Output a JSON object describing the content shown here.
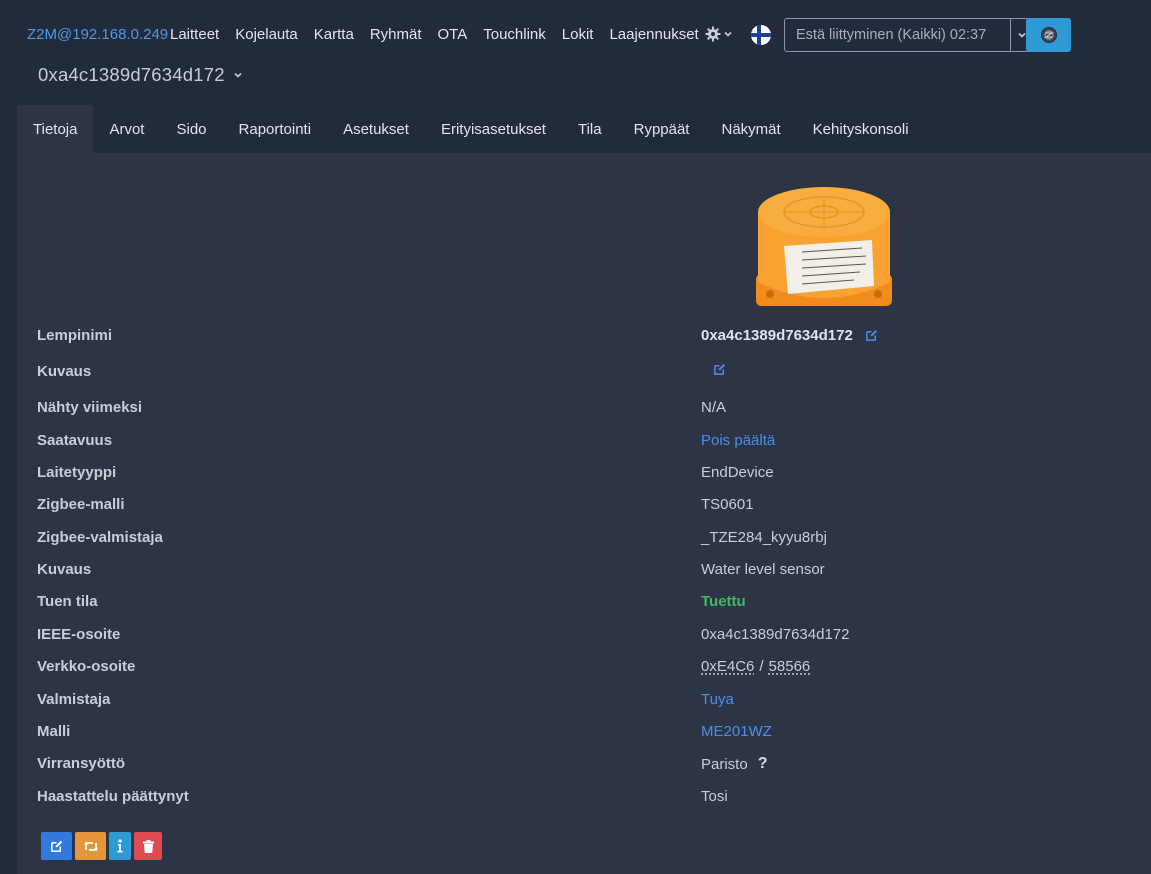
{
  "navbar": {
    "brand": "Z2M@192.168.0.249",
    "links": [
      "Laitteet",
      "Kojelauta",
      "Kartta",
      "Ryhmät",
      "OTA",
      "Touchlink",
      "Lokit",
      "Laajennukset"
    ],
    "settings_icon": "gear-icon",
    "language_icon": "finnish-flag-icon",
    "permit_join_label": "Estä liittyminen (Kaikki) 02:37",
    "permit_dropdown_icon": "chevron-down-icon",
    "zigbee_icon": "zigbee-logo-icon"
  },
  "device": {
    "title": "0xa4c1389d7634d172"
  },
  "tabs": [
    "Tietoja",
    "Arvot",
    "Sido",
    "Raportointi",
    "Asetukset",
    "Erityisasetukset",
    "Tila",
    "Ryppäät",
    "Näkymät",
    "Kehityskonsoli"
  ],
  "active_tab": "Tietoja",
  "info": {
    "friendly_name": {
      "label": "Lempinimi",
      "value": "0xa4c1389d7634d172"
    },
    "description": {
      "label": "Kuvaus",
      "value": ""
    },
    "last_seen": {
      "label": "Nähty viimeksi",
      "value": "N/A"
    },
    "availability": {
      "label": "Saatavuus",
      "value": "Pois päältä"
    },
    "device_type": {
      "label": "Laitetyyppi",
      "value": "EndDevice"
    },
    "zigbee_model": {
      "label": "Zigbee-malli",
      "value": "TS0601"
    },
    "zigbee_manufacturer": {
      "label": "Zigbee-valmistaja",
      "value": "_TZE284_kyyu8rbj"
    },
    "definition_description": {
      "label": "Kuvaus",
      "value": "Water level sensor"
    },
    "support_status": {
      "label": "Tuen tila",
      "value": "Tuettu"
    },
    "ieee_address": {
      "label": "IEEE-osoite",
      "value": "0xa4c1389d7634d172"
    },
    "network_address": {
      "label": "Verkko-osoite",
      "hex": "0xE4C6",
      "separator": "/",
      "dec": "58566"
    },
    "manufacturer": {
      "label": "Valmistaja",
      "value": "Tuya"
    },
    "model": {
      "label": "Malli",
      "value": "ME201WZ"
    },
    "power_source": {
      "label": "Virransyöttö",
      "value": "Paristo",
      "help": "?"
    },
    "interview_completed": {
      "label": "Haastattelu päättynyt",
      "value": "Tosi"
    }
  },
  "actions": {
    "rename_icon": "edit-icon",
    "reconfigure_icon": "retweet-icon",
    "interview_icon": "info-icon",
    "remove_icon": "trash-icon"
  },
  "colors": {
    "background": "#222b3b",
    "card": "#2c3446",
    "link": "#4d8fe8",
    "success": "#3dbb5e",
    "primary": "#3479e0",
    "warning": "#e5963a",
    "info": "#2d9ad6",
    "danger": "#dd4a4f"
  }
}
